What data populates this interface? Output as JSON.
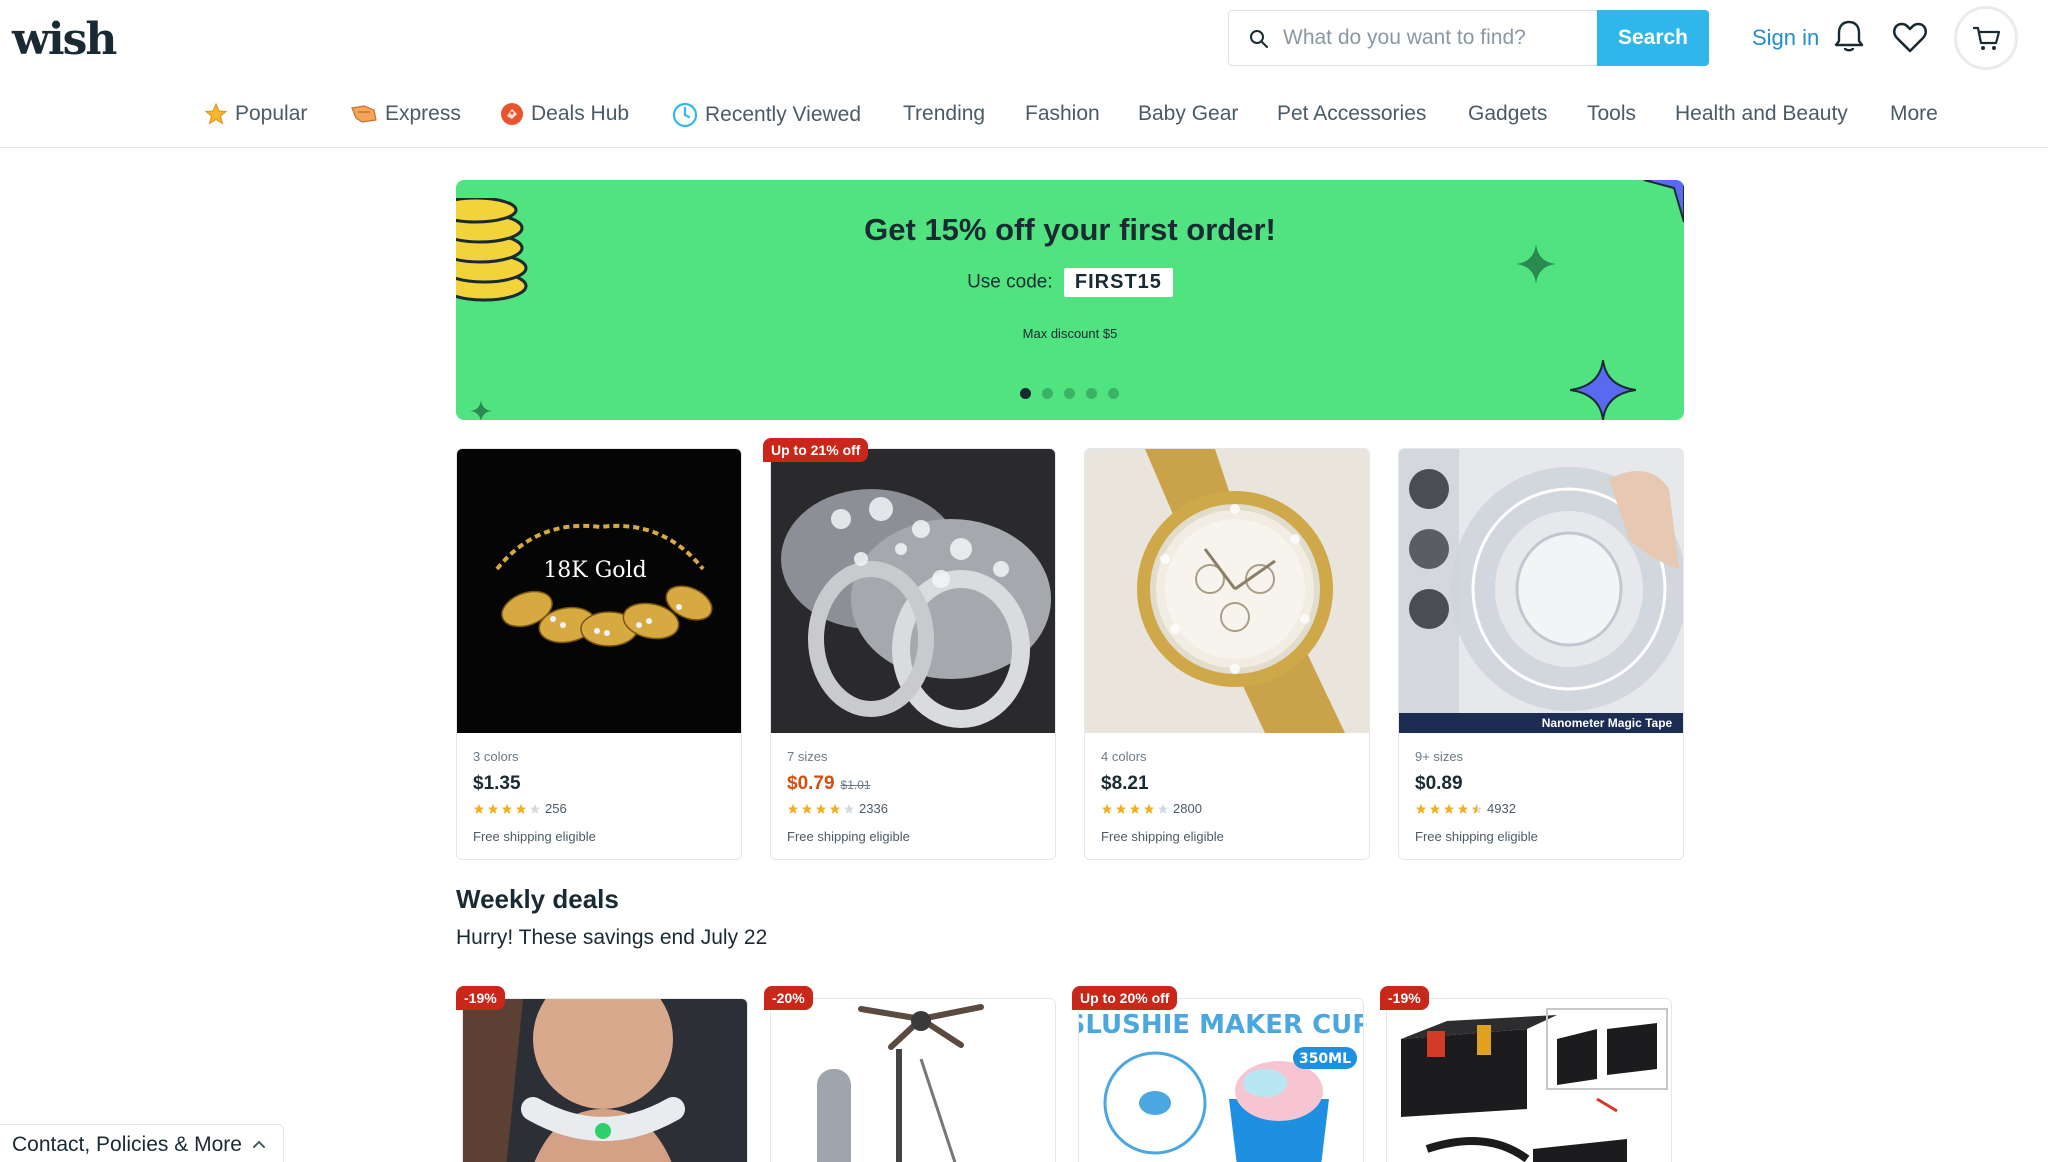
{
  "header": {
    "logo": "wish",
    "search_placeholder": "What do you want to find?",
    "search_button": "Search",
    "sign_in": "Sign in"
  },
  "nav": {
    "items": [
      {
        "label": "Popular",
        "icon": "star-icon"
      },
      {
        "label": "Express",
        "icon": "express-icon"
      },
      {
        "label": "Deals Hub",
        "icon": "deals-icon"
      },
      {
        "label": "Recently Viewed",
        "icon": "clock-icon"
      },
      {
        "label": "Trending"
      },
      {
        "label": "Fashion"
      },
      {
        "label": "Baby Gear"
      },
      {
        "label": "Pet Accessories"
      },
      {
        "label": "Gadgets"
      },
      {
        "label": "Tools"
      },
      {
        "label": "Health and Beauty"
      },
      {
        "label": "More"
      }
    ]
  },
  "banner": {
    "title": "Get 15% off your first order!",
    "code_label": "Use code:",
    "code": "FIRST15",
    "note": "Max discount $5",
    "background": "#50e37f",
    "slides": 5,
    "active_slide": 1
  },
  "products": [
    {
      "badge": "",
      "meta": "3 colors",
      "price": "$1.35",
      "old_price": "",
      "rating": 4,
      "reviews": "256",
      "shipping": "Free shipping eligible",
      "image_text": "18K Gold"
    },
    {
      "badge": "Up to 21% off",
      "meta": "7 sizes",
      "price": "$0.79",
      "old_price": "$1.01",
      "rating": 4,
      "reviews": "2336",
      "shipping": "Free shipping eligible"
    },
    {
      "badge": "",
      "meta": "4 colors",
      "price": "$8.21",
      "old_price": "",
      "rating": 4,
      "reviews": "2800",
      "shipping": "Free shipping eligible"
    },
    {
      "badge": "",
      "meta": "9+ sizes",
      "price": "$0.89",
      "old_price": "",
      "rating": 4.5,
      "reviews": "4932",
      "shipping": "Free shipping eligible",
      "image_text": "Nanometer Magic Tape"
    }
  ],
  "weekly": {
    "title": "Weekly deals",
    "subtitle": "Hurry! These savings end July 22",
    "deals": [
      {
        "badge": "-19%"
      },
      {
        "badge": "-20%"
      },
      {
        "badge": "Up to 20% off",
        "image_text": "SLUSHIE MAKER CUP",
        "image_subtext": "350ML"
      },
      {
        "badge": "-19%"
      }
    ]
  },
  "footer": {
    "label": "Contact, Policies & More"
  },
  "colors": {
    "accent": "#2fb7ec",
    "link": "#2290c6",
    "badge": "#c8271a",
    "sale_price": "#d74e09",
    "star": "#f2b01e"
  }
}
